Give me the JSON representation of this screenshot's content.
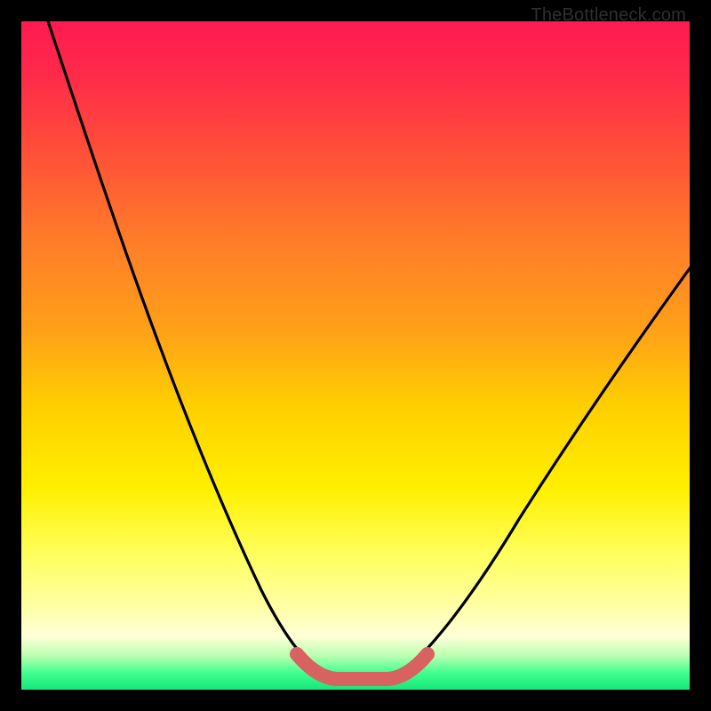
{
  "attribution": "TheBottleneck.com",
  "chart_data": {
    "type": "line",
    "title": "",
    "xlabel": "",
    "ylabel": "",
    "xlim": [
      0,
      100
    ],
    "ylim": [
      0,
      100
    ],
    "grid": false,
    "legend": false,
    "series": [
      {
        "name": "left-curve",
        "x": [
          4,
          8,
          12,
          16,
          20,
          24,
          28,
          32,
          36,
          40,
          43,
          46
        ],
        "values": [
          100,
          89,
          78,
          67,
          56,
          46,
          36,
          27,
          18,
          10,
          5,
          2
        ]
      },
      {
        "name": "valley-floor",
        "x": [
          46,
          48,
          50,
          52,
          54,
          56
        ],
        "values": [
          2,
          1.5,
          1.5,
          1.5,
          1.5,
          2
        ]
      },
      {
        "name": "right-curve",
        "x": [
          56,
          60,
          66,
          72,
          78,
          84,
          90,
          96,
          100
        ],
        "values": [
          2,
          6,
          14,
          23,
          32,
          41,
          50,
          58,
          63
        ]
      },
      {
        "name": "highlight-band",
        "x": [
          42,
          44,
          46,
          48,
          50,
          52,
          54,
          56,
          58
        ],
        "values": [
          5,
          3,
          2,
          1.5,
          1.5,
          1.5,
          2,
          3,
          5
        ]
      }
    ],
    "colors": {
      "curve": "#000000",
      "highlight": "#d8625f",
      "gradient_top": "#ff1a50",
      "gradient_bottom": "#15e77a"
    }
  }
}
